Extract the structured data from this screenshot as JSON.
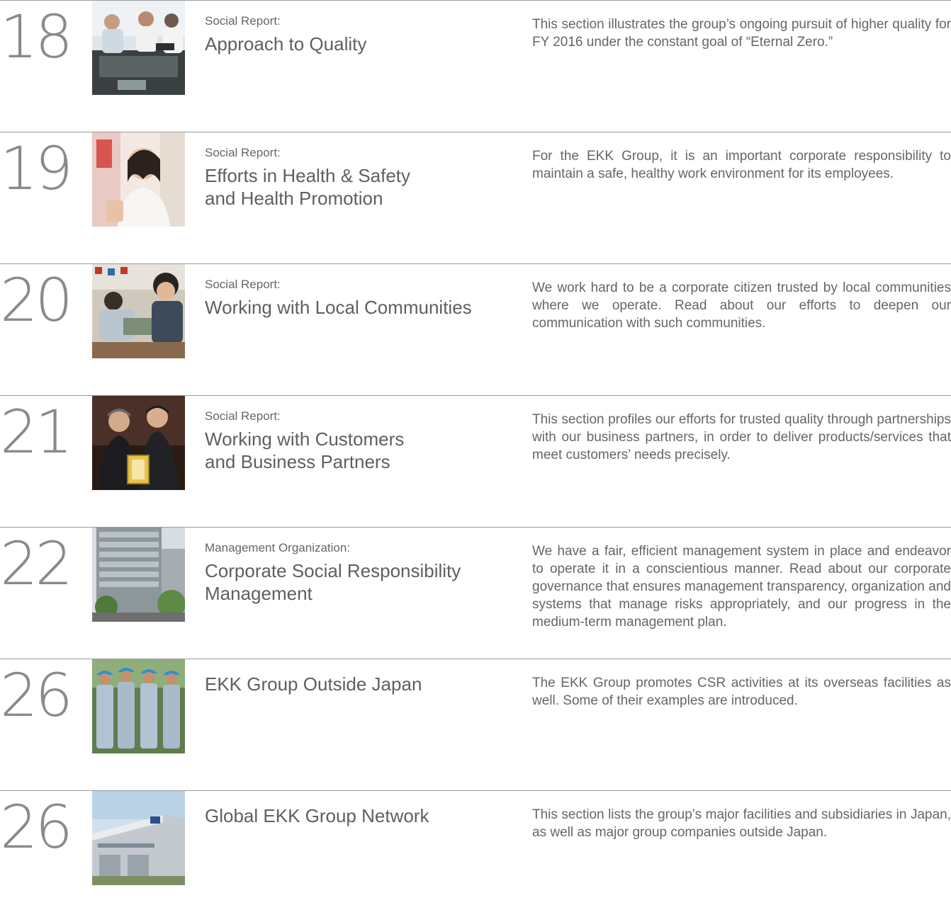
{
  "entries": [
    {
      "page": "18",
      "category": "Social Report:",
      "title_lines": [
        "Approach to Quality"
      ],
      "description": "This section illustrates the group’s ongoing pursuit of higher quality for FY 2016 under the constant goal of “Eternal Zero.”"
    },
    {
      "page": "19",
      "category": "Social Report:",
      "title_lines": [
        "Efforts in Health & Safety",
        "and Health Promotion"
      ],
      "description": "For the EKK Group, it is an important corporate responsibility to maintain a safe, healthy work environment for its employees."
    },
    {
      "page": "20",
      "category": "Social Report:",
      "title_lines": [
        "Working with Local Communities"
      ],
      "description": "We work hard to be a corporate citizen trusted by local communities where we operate. Read about our efforts to deepen our communication with such communities."
    },
    {
      "page": "21",
      "category": "Social Report:",
      "title_lines": [
        "Working with Customers",
        "and Business Partners"
      ],
      "description": "This section profiles our efforts for trusted quality through partnerships with our business partners, in order to deliver products/services that meet customers’ needs precisely."
    },
    {
      "page": "22",
      "category": "Management Organization:",
      "title_lines": [
        "Corporate Social Responsibility",
        "Management"
      ],
      "description": "We have a fair, efficient management system in place and endeavor to operate it in a conscientious manner. Read about our corporate governance that ensures management transparency, organization and systems that manage risks appropriately, and our progress in the medium-term management plan."
    },
    {
      "page": "26",
      "category": "",
      "title_lines": [
        "EKK Group Outside Japan"
      ],
      "description": "The EKK Group promotes CSR activities at its overseas facilities as well. Some of their examples are introduced."
    },
    {
      "page": "26",
      "category": "",
      "title_lines": [
        "Global EKK Group Network"
      ],
      "description": "This section lists the group’s major facilities and subsidiaries in Japan, as well as major group companies outside Japan."
    }
  ]
}
